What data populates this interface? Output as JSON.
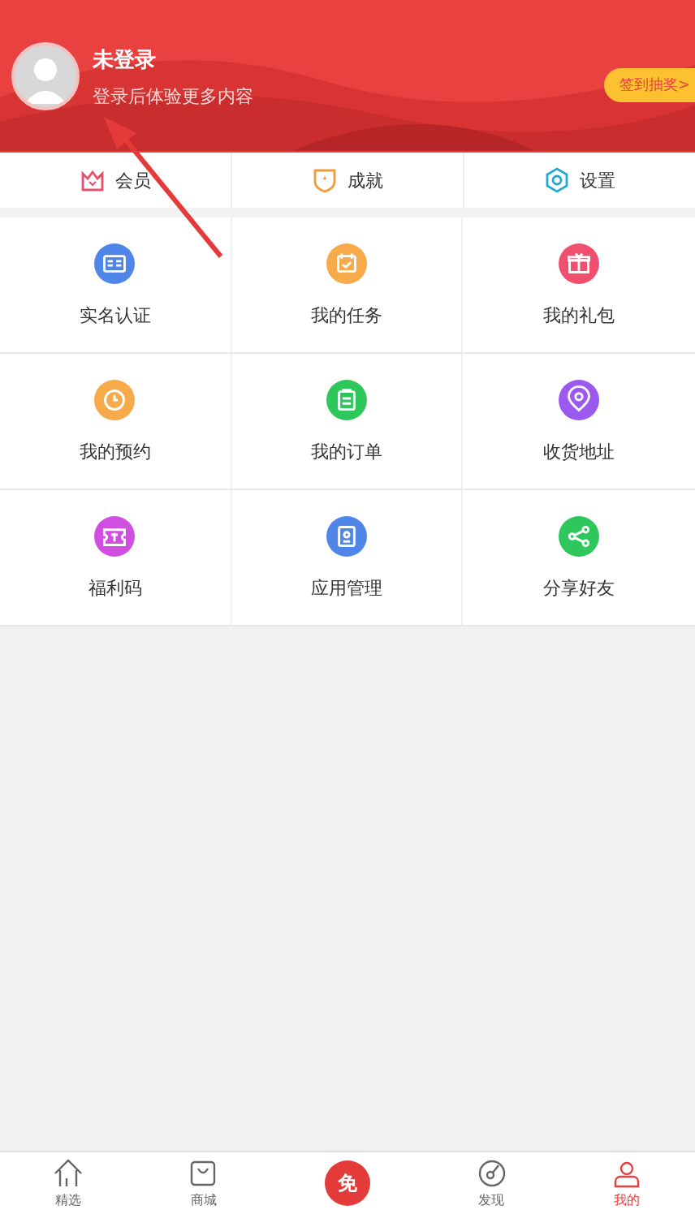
{
  "profile": {
    "name": "未登录",
    "subtitle": "登录后体验更多内容",
    "badge": "签到抽奖>"
  },
  "quick_tabs": [
    {
      "label": "会员"
    },
    {
      "label": "成就"
    },
    {
      "label": "设置"
    }
  ],
  "grid": [
    {
      "label": "实名认证",
      "color": "#4f86e8"
    },
    {
      "label": "我的任务",
      "color": "#f7aa4a"
    },
    {
      "label": "我的礼包",
      "color": "#f0506e"
    },
    {
      "label": "我的预约",
      "color": "#f7aa4a"
    },
    {
      "label": "我的订单",
      "color": "#2dc75c"
    },
    {
      "label": "收货地址",
      "color": "#9b59f0"
    },
    {
      "label": "福利码",
      "color": "#d04fe0"
    },
    {
      "label": "应用管理",
      "color": "#4f86e8"
    },
    {
      "label": "分享好友",
      "color": "#2dc75c"
    }
  ],
  "bottom_nav": [
    {
      "label": "精选",
      "kind": "tab",
      "selected": false
    },
    {
      "label": "商城",
      "kind": "tab",
      "selected": false
    },
    {
      "label": "免",
      "kind": "center",
      "selected": false
    },
    {
      "label": "发现",
      "kind": "tab",
      "selected": false
    },
    {
      "label": "我的",
      "kind": "tab",
      "selected": true
    }
  ]
}
